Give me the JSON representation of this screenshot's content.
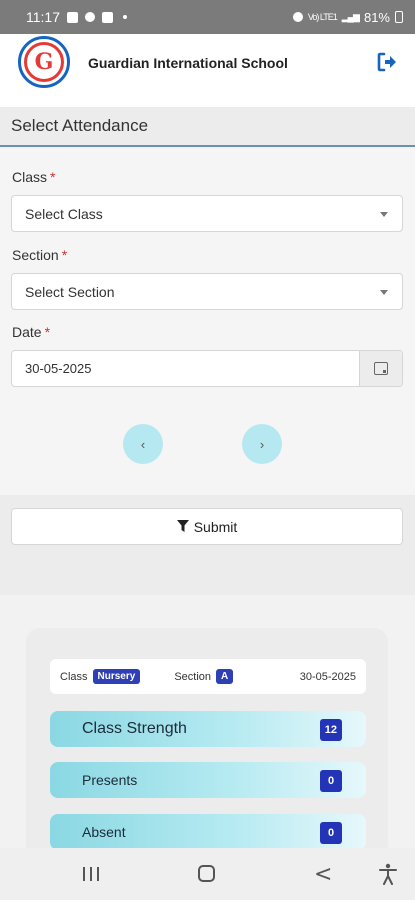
{
  "status_bar": {
    "time": "11:17",
    "network_small": "Vo) LTE1",
    "battery": "81%"
  },
  "header": {
    "school_name": "Guardian International School",
    "logo_letter": "G",
    "logo_icon": "school-crest-logo",
    "logout_icon": "logout-icon"
  },
  "page": {
    "title": "Select Attendance"
  },
  "form": {
    "class_label": "Class",
    "class_value": "Select Class",
    "section_label": "Section",
    "section_value": "Select Section",
    "date_label": "Date",
    "date_value": "30-05-2025",
    "required_mark": "*",
    "prev_label": "‹",
    "next_label": "›",
    "submit_label": "Submit"
  },
  "summary": {
    "class_label": "Class",
    "class_value": "Nursery",
    "section_label": "Section",
    "section_value": "A",
    "date": "30-05-2025",
    "stats": [
      {
        "label": "Class Strength",
        "value": "12"
      },
      {
        "label": "Presents",
        "value": "0"
      },
      {
        "label": "Absent",
        "value": "0"
      }
    ]
  },
  "colors": {
    "accent": "#2335b6",
    "stat_gradient_start": "#8ad8e3",
    "nav_circle": "#b5e8f0",
    "logo_red": "#e53935",
    "logo_blue": "#1565c0"
  }
}
